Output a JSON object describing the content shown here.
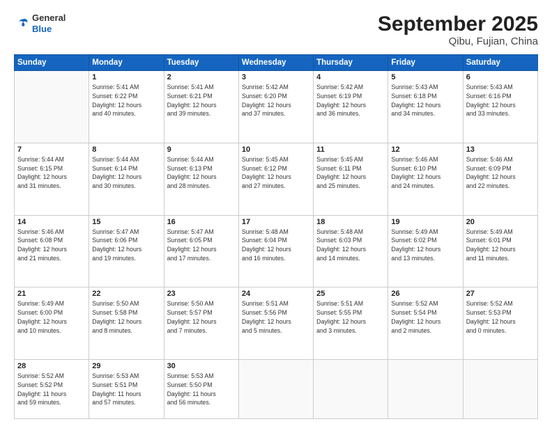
{
  "header": {
    "logo": {
      "general": "General",
      "blue": "Blue"
    },
    "title": "September 2025",
    "location": "Qibu, Fujian, China"
  },
  "weekdays": [
    "Sunday",
    "Monday",
    "Tuesday",
    "Wednesday",
    "Thursday",
    "Friday",
    "Saturday"
  ],
  "weeks": [
    [
      {
        "day": null
      },
      {
        "day": "1",
        "sunrise": "5:41 AM",
        "sunset": "6:22 PM",
        "daylight": "12 hours and 40 minutes."
      },
      {
        "day": "2",
        "sunrise": "5:41 AM",
        "sunset": "6:21 PM",
        "daylight": "12 hours and 39 minutes."
      },
      {
        "day": "3",
        "sunrise": "5:42 AM",
        "sunset": "6:20 PM",
        "daylight": "12 hours and 37 minutes."
      },
      {
        "day": "4",
        "sunrise": "5:42 AM",
        "sunset": "6:19 PM",
        "daylight": "12 hours and 36 minutes."
      },
      {
        "day": "5",
        "sunrise": "5:43 AM",
        "sunset": "6:18 PM",
        "daylight": "12 hours and 34 minutes."
      },
      {
        "day": "6",
        "sunrise": "5:43 AM",
        "sunset": "6:16 PM",
        "daylight": "12 hours and 33 minutes."
      }
    ],
    [
      {
        "day": "7",
        "sunrise": "5:44 AM",
        "sunset": "6:15 PM",
        "daylight": "12 hours and 31 minutes."
      },
      {
        "day": "8",
        "sunrise": "5:44 AM",
        "sunset": "6:14 PM",
        "daylight": "12 hours and 30 minutes."
      },
      {
        "day": "9",
        "sunrise": "5:44 AM",
        "sunset": "6:13 PM",
        "daylight": "12 hours and 28 minutes."
      },
      {
        "day": "10",
        "sunrise": "5:45 AM",
        "sunset": "6:12 PM",
        "daylight": "12 hours and 27 minutes."
      },
      {
        "day": "11",
        "sunrise": "5:45 AM",
        "sunset": "6:11 PM",
        "daylight": "12 hours and 25 minutes."
      },
      {
        "day": "12",
        "sunrise": "5:46 AM",
        "sunset": "6:10 PM",
        "daylight": "12 hours and 24 minutes."
      },
      {
        "day": "13",
        "sunrise": "5:46 AM",
        "sunset": "6:09 PM",
        "daylight": "12 hours and 22 minutes."
      }
    ],
    [
      {
        "day": "14",
        "sunrise": "5:46 AM",
        "sunset": "6:08 PM",
        "daylight": "12 hours and 21 minutes."
      },
      {
        "day": "15",
        "sunrise": "5:47 AM",
        "sunset": "6:06 PM",
        "daylight": "12 hours and 19 minutes."
      },
      {
        "day": "16",
        "sunrise": "5:47 AM",
        "sunset": "6:05 PM",
        "daylight": "12 hours and 17 minutes."
      },
      {
        "day": "17",
        "sunrise": "5:48 AM",
        "sunset": "6:04 PM",
        "daylight": "12 hours and 16 minutes."
      },
      {
        "day": "18",
        "sunrise": "5:48 AM",
        "sunset": "6:03 PM",
        "daylight": "12 hours and 14 minutes."
      },
      {
        "day": "19",
        "sunrise": "5:49 AM",
        "sunset": "6:02 PM",
        "daylight": "12 hours and 13 minutes."
      },
      {
        "day": "20",
        "sunrise": "5:49 AM",
        "sunset": "6:01 PM",
        "daylight": "12 hours and 11 minutes."
      }
    ],
    [
      {
        "day": "21",
        "sunrise": "5:49 AM",
        "sunset": "6:00 PM",
        "daylight": "12 hours and 10 minutes."
      },
      {
        "day": "22",
        "sunrise": "5:50 AM",
        "sunset": "5:58 PM",
        "daylight": "12 hours and 8 minutes."
      },
      {
        "day": "23",
        "sunrise": "5:50 AM",
        "sunset": "5:57 PM",
        "daylight": "12 hours and 7 minutes."
      },
      {
        "day": "24",
        "sunrise": "5:51 AM",
        "sunset": "5:56 PM",
        "daylight": "12 hours and 5 minutes."
      },
      {
        "day": "25",
        "sunrise": "5:51 AM",
        "sunset": "5:55 PM",
        "daylight": "12 hours and 3 minutes."
      },
      {
        "day": "26",
        "sunrise": "5:52 AM",
        "sunset": "5:54 PM",
        "daylight": "12 hours and 2 minutes."
      },
      {
        "day": "27",
        "sunrise": "5:52 AM",
        "sunset": "5:53 PM",
        "daylight": "12 hours and 0 minutes."
      }
    ],
    [
      {
        "day": "28",
        "sunrise": "5:52 AM",
        "sunset": "5:52 PM",
        "daylight": "11 hours and 59 minutes."
      },
      {
        "day": "29",
        "sunrise": "5:53 AM",
        "sunset": "5:51 PM",
        "daylight": "11 hours and 57 minutes."
      },
      {
        "day": "30",
        "sunrise": "5:53 AM",
        "sunset": "5:50 PM",
        "daylight": "11 hours and 56 minutes."
      },
      {
        "day": null
      },
      {
        "day": null
      },
      {
        "day": null
      },
      {
        "day": null
      }
    ]
  ]
}
